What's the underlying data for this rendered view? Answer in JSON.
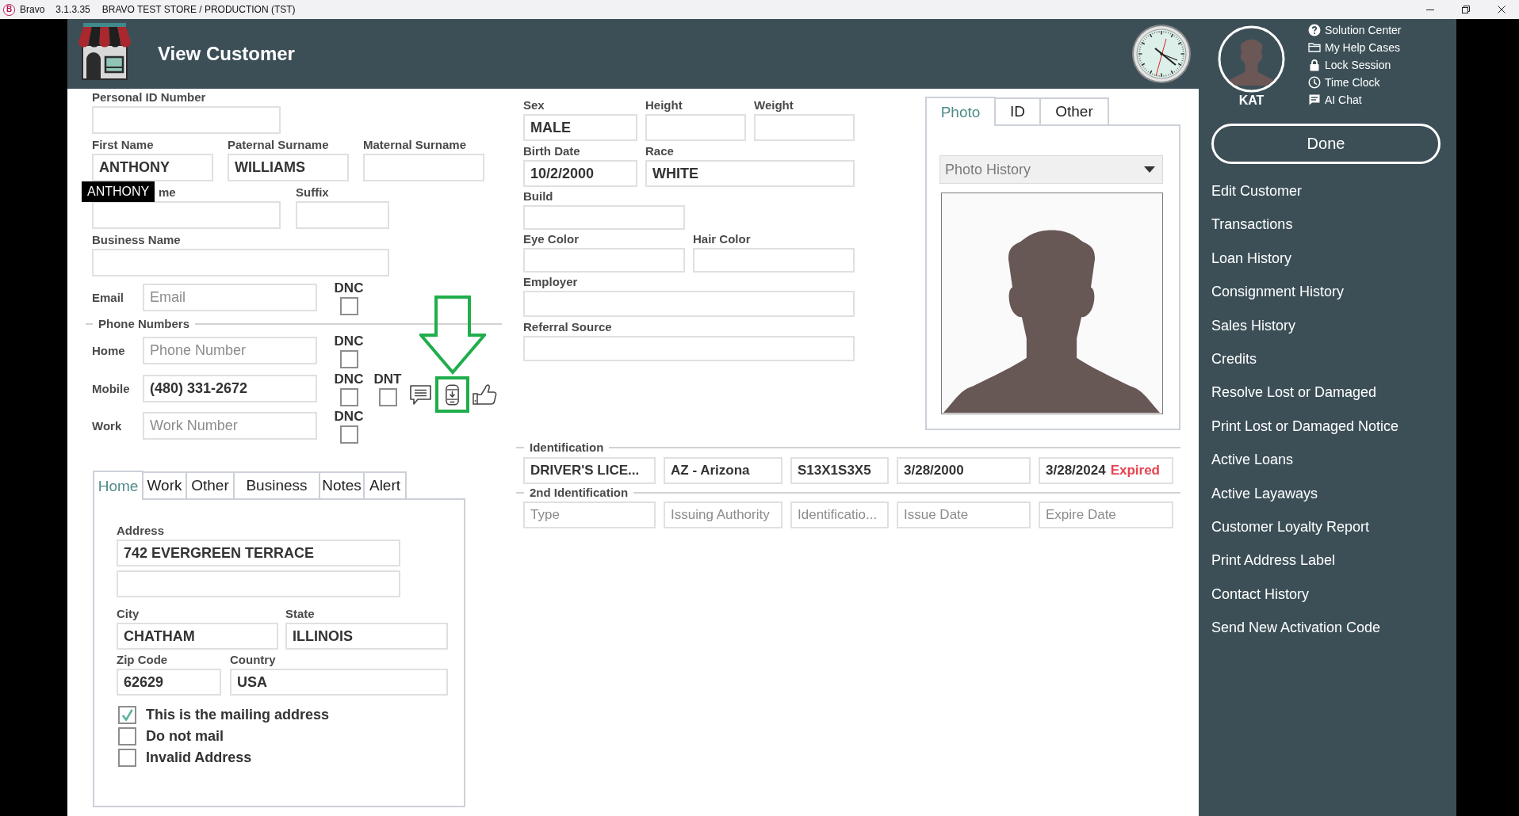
{
  "title_bar": {
    "logo": "B",
    "app": "Bravo",
    "version": "3.1.3.35",
    "store": "BRAVO TEST STORE / PRODUCTION (TST)"
  },
  "header": {
    "title": "View Customer"
  },
  "user": {
    "name": "KAT"
  },
  "help_links": [
    {
      "kind": "help",
      "label": "Solution Center"
    },
    {
      "kind": "folder",
      "label": "My Help Cases"
    },
    {
      "kind": "lock",
      "label": "Lock Session"
    },
    {
      "kind": "clock",
      "label": "Time Clock"
    },
    {
      "kind": "chat",
      "label": "AI Chat"
    }
  ],
  "done_button": "Done",
  "menu": [
    "Edit Customer",
    "Transactions",
    "Loan History",
    "Consignment History",
    "Sales History",
    "Credits",
    "Resolve Lost or Damaged",
    "Print Lost or Damaged Notice",
    "Active Loans",
    "Active Layaways",
    "Customer Loyalty Report",
    "Print Address Label",
    "Contact History",
    "Send New Activation Code"
  ],
  "personal": {
    "rows": [
      [
        {
          "label": "Personal ID Number"
        }
      ],
      [
        {
          "label": "First Name",
          "value": "ANTHONY"
        },
        {
          "label": "Paternal Surname",
          "value": "WILLIAMS"
        },
        {
          "label": "Maternal Surname"
        }
      ],
      [
        {
          "label": "me"
        },
        {
          "label": "Suffix"
        }
      ],
      [
        {
          "label": "Business Name"
        }
      ]
    ],
    "tooltip": "ANTHONY"
  },
  "email": {
    "label": "Email",
    "placeholder": "Email",
    "checks": [
      {
        "label": "DNC",
        "checked": false
      }
    ]
  },
  "phone_numbers": {
    "title": "Phone Numbers",
    "rows": [
      {
        "label": "Home",
        "placeholder": "Phone Number",
        "checks": [
          {
            "label": "DNC",
            "checked": false
          }
        ]
      },
      {
        "label": "Mobile",
        "value": "(480) 331-2672",
        "checks": [
          {
            "label": "DNC",
            "checked": false
          },
          {
            "label": "DNT",
            "checked": false
          }
        ],
        "actions": [
          {
            "kind": "message",
            "highlighted": false
          },
          {
            "kind": "phone_download",
            "highlighted": true
          },
          {
            "kind": "thumbs_up",
            "highlighted": false
          }
        ]
      },
      {
        "label": "Work",
        "placeholder": "Work Number",
        "checks": [
          {
            "label": "DNC",
            "checked": false
          }
        ]
      }
    ]
  },
  "address_tabs": [
    {
      "label": "Home",
      "selected": true
    },
    {
      "label": "Work",
      "selected": false
    },
    {
      "label": "Other",
      "selected": false
    },
    {
      "label": "Business",
      "selected": false
    },
    {
      "label": "Notes",
      "selected": false
    },
    {
      "label": "Alert",
      "selected": false
    }
  ],
  "address": {
    "label": "Address",
    "line_1": "742 EVERGREEN TERRACE",
    "fields": [
      {
        "label": "City",
        "value": "CHATHAM"
      },
      {
        "label": "State",
        "value": "ILLINOIS"
      },
      {
        "label": "Zip Code",
        "value": "62629"
      },
      {
        "label": "Country",
        "value": "USA"
      }
    ],
    "options": [
      {
        "label": "This is the mailing address",
        "checked": true
      },
      {
        "label": "Do not mail",
        "checked": false
      },
      {
        "label": "Invalid Address",
        "checked": false
      }
    ]
  },
  "physical": [
    [
      {
        "label": "Sex",
        "value": "MALE"
      },
      {
        "label": "Height"
      },
      {
        "label": "Weight"
      }
    ],
    [
      {
        "label": "Birth Date",
        "value": "10/2/2000"
      },
      {
        "label": "Race",
        "value": "WHITE"
      }
    ],
    [
      {
        "label": "Build"
      }
    ],
    [
      {
        "label": "Eye Color"
      },
      {
        "label": "Hair Color"
      }
    ],
    [
      {
        "label": "Employer"
      }
    ],
    [
      {
        "label": "Referral Source"
      }
    ]
  ],
  "photo_tabs": [
    {
      "label": "Photo",
      "selected": true
    },
    {
      "label": "ID",
      "selected": false
    },
    {
      "label": "Other",
      "selected": false
    }
  ],
  "photo_history": {
    "placeholder": "Photo History"
  },
  "identification": {
    "title": "Identification",
    "fields": [
      {
        "value": "DRIVER'S LICE..."
      },
      {
        "value": "AZ - Arizona"
      },
      {
        "value": "S13X1S3X5"
      },
      {
        "value": "3/28/2000"
      },
      {
        "value": "3/28/2024",
        "status": "Expired"
      }
    ]
  },
  "second_identification": {
    "title": "2nd Identification",
    "fields": [
      {
        "placeholder": "Type"
      },
      {
        "placeholder": "Issuing Authority"
      },
      {
        "placeholder": "Identificatio..."
      },
      {
        "placeholder": "Issue Date"
      },
      {
        "placeholder": "Expire Date"
      }
    ]
  }
}
